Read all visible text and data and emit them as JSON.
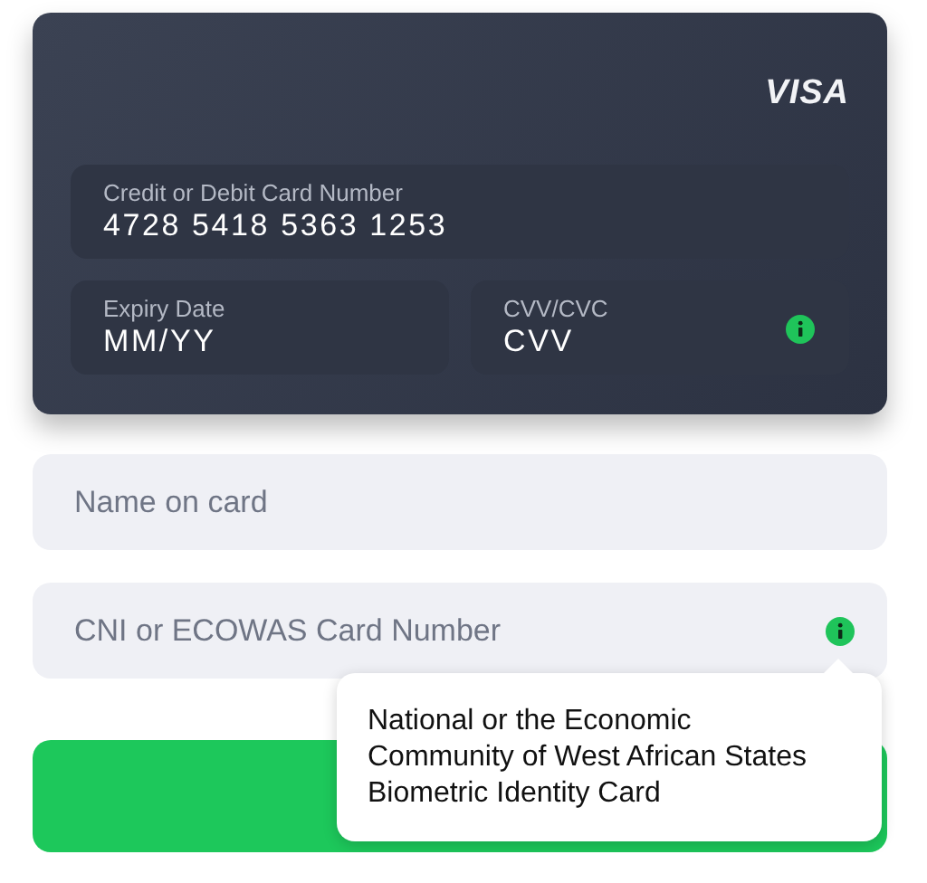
{
  "card": {
    "brand": "VISA",
    "fields": [
      {
        "kind": "wide",
        "label": "Credit or Debit Card Number",
        "value": "4728 5418 5363 1253",
        "info": false
      },
      {
        "kind": "half",
        "label": "Expiry Date",
        "placeholder": "MM/YY",
        "info": false
      },
      {
        "kind": "half",
        "label": "CVV/CVC",
        "placeholder": "CVV",
        "info": true
      }
    ]
  },
  "form": {
    "fields": [
      {
        "placeholder": "Name on card",
        "info": false
      },
      {
        "placeholder": "CNI or ECOWAS Card Number",
        "info": true
      }
    ]
  },
  "tooltip": {
    "text": "National or the Economic Community of West African States Biometric Identity Card"
  }
}
